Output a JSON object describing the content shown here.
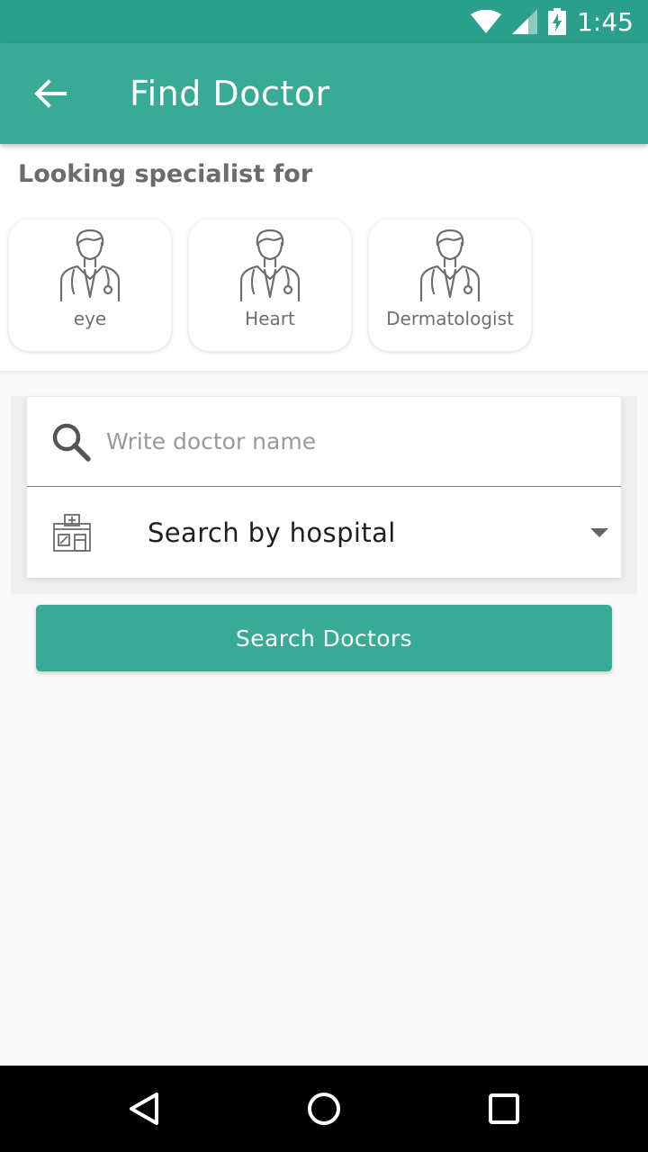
{
  "status_bar": {
    "time": "1:45",
    "icons": [
      "wifi-icon",
      "signal-icon",
      "battery-charging-icon"
    ]
  },
  "app_bar": {
    "title": "Find Doctor",
    "back_icon": "arrow-left-icon"
  },
  "specialists": {
    "heading": "Looking specialist for",
    "items": [
      {
        "label": "eye",
        "icon": "doctor-icon"
      },
      {
        "label": "Heart",
        "icon": "doctor-icon"
      },
      {
        "label": "Dermatologist",
        "icon": "doctor-icon"
      }
    ]
  },
  "search": {
    "name_placeholder": "Write doctor name",
    "name_value": "",
    "hospital_label": "Search by hospital",
    "button_label": "Search Doctors"
  },
  "nav_bar": {
    "buttons": [
      "back-triangle-icon",
      "home-circle-icon",
      "recents-square-icon"
    ]
  },
  "colors": {
    "status_bar": "#2a9f8c",
    "primary": "#38ab97"
  }
}
